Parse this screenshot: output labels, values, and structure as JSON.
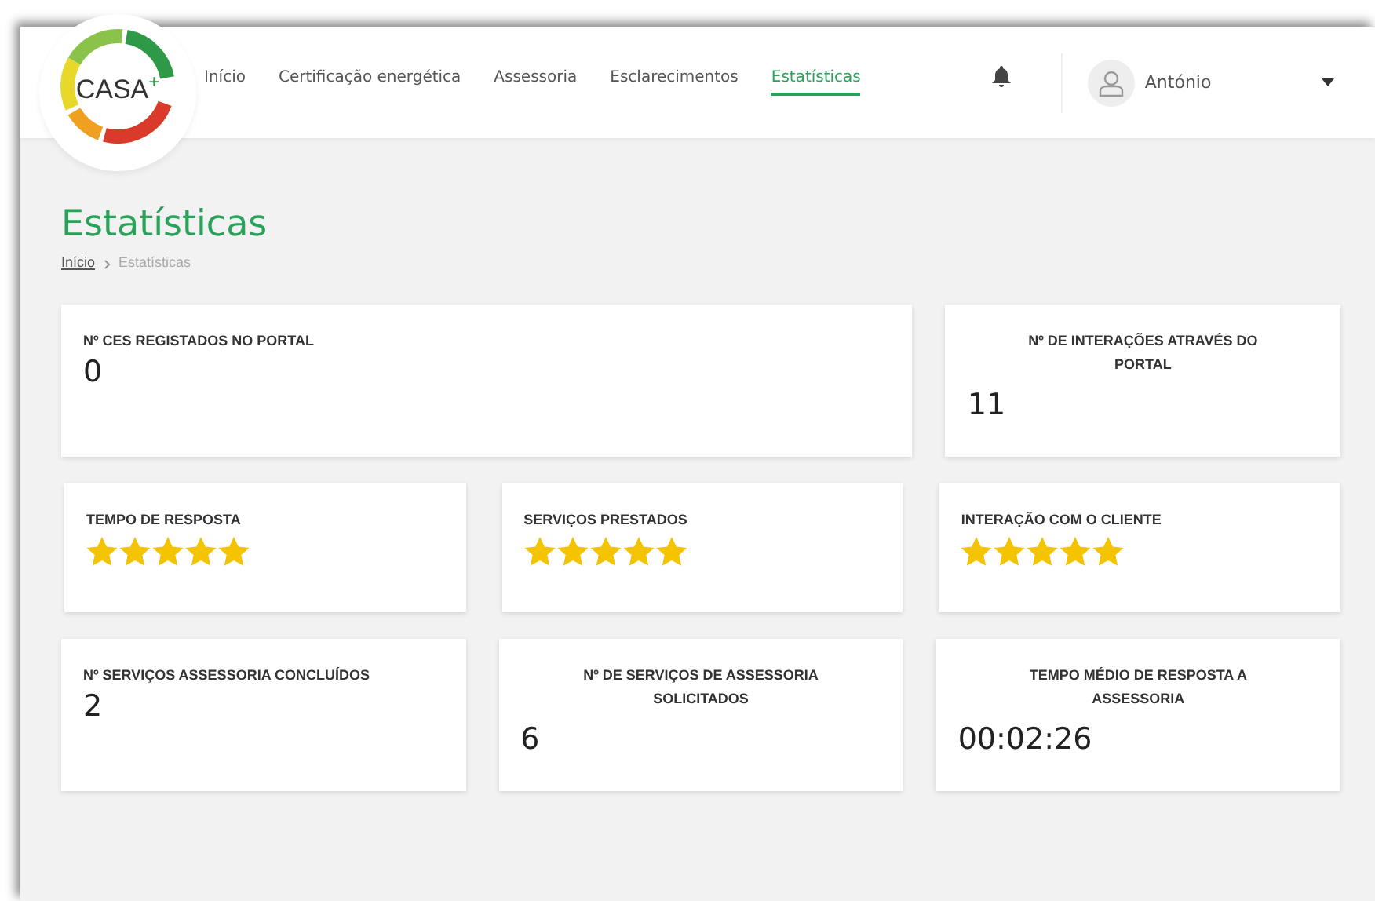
{
  "logo": {
    "text": "CASA$^{+}$"
  },
  "nav": [
    {
      "label": "Início",
      "selected": false
    },
    {
      "label": "Certificação energética",
      "selected": false
    },
    {
      "label": "Assessoria",
      "selected": false
    },
    {
      "label": "Esclarecimentos",
      "selected": false
    },
    {
      "label": "Estatísticas",
      "selected": true
    }
  ],
  "user": {
    "name": "António"
  },
  "page": {
    "title": "Estatísticas",
    "breadcrumb": [
      {
        "label": "Início",
        "link": true
      },
      {
        "label": "Estatísticas",
        "link": false
      }
    ]
  },
  "rows": [
    [
      {
        "kind": "value",
        "title": "Nº CES REGISTADOS NO PORTAL",
        "title_centered": false,
        "value": "0",
        "wide": true
      },
      {
        "kind": "value",
        "title": "Nº DE INTERAÇÕES ATRAVÉS DO PORTAL",
        "title_centered": true,
        "value": "11",
        "wide": false
      }
    ],
    [
      {
        "kind": "rating",
        "title": "TEMPO DE RESPOSTA",
        "title_centered": false,
        "stars": 5
      },
      {
        "kind": "rating",
        "title": "SERVIÇOS PRESTADOS",
        "title_centered": false,
        "stars": 5
      },
      {
        "kind": "rating",
        "title": "INTERAÇÃO COM O CLIENTE",
        "title_centered": false,
        "stars": 5
      }
    ],
    [
      {
        "kind": "value",
        "title": "Nº SERVIÇOS ASSESSORIA CONCLUÍDOS",
        "title_centered": false,
        "value": "2"
      },
      {
        "kind": "value",
        "title": "Nº DE SERVIÇOS DE ASSESSORIA SOLICITADOS",
        "title_centered": true,
        "value": "6"
      },
      {
        "kind": "value",
        "title": "TEMPO MÉDIO DE RESPOSTA A ASSESSORIA",
        "title_centered": true,
        "value": "00:02:26"
      }
    ]
  ]
}
